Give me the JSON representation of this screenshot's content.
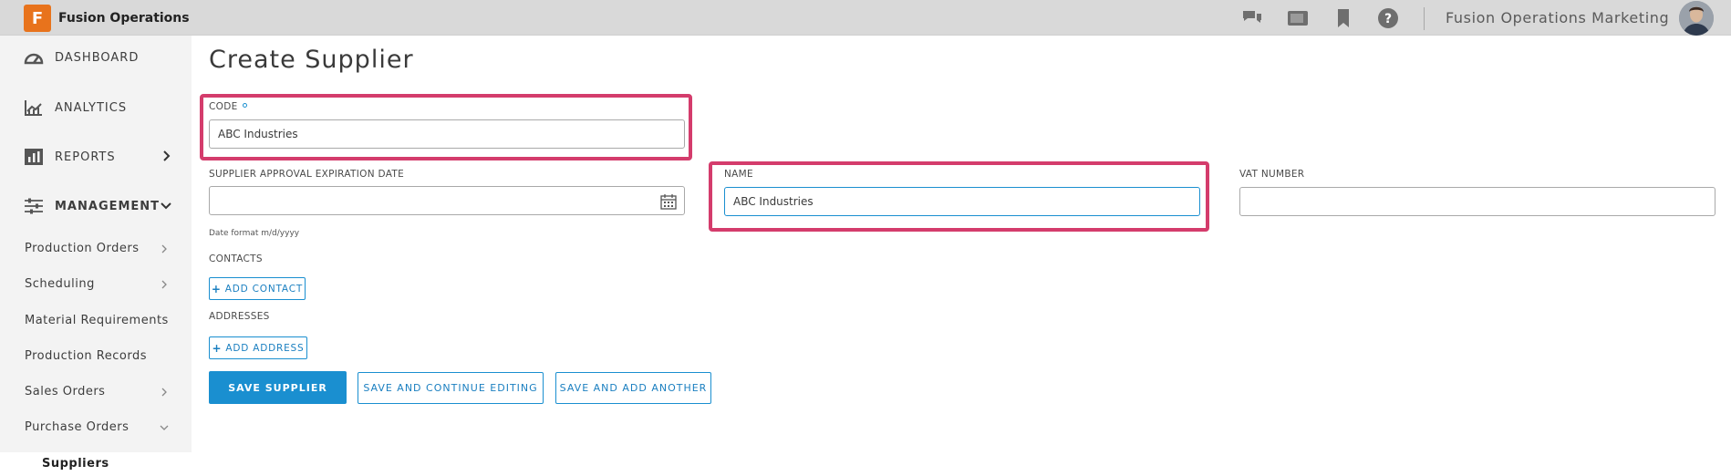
{
  "app": {
    "name": "Fusion Operations",
    "logo_letter": "F"
  },
  "topbar": {
    "user_label": "Fusion Operations Marketing",
    "icons": [
      "chat-icon",
      "tablet-icon",
      "bookmark-icon",
      "help-icon"
    ]
  },
  "sidebar": {
    "main": [
      {
        "label": "DASHBOARD",
        "icon": "gauge-icon"
      },
      {
        "label": "ANALYTICS",
        "icon": "analytics-icon"
      },
      {
        "label": "REPORTS",
        "icon": "reports-icon"
      },
      {
        "label": "MANAGEMENT",
        "icon": "sliders-icon"
      }
    ],
    "sub": [
      {
        "label": "Production Orders"
      },
      {
        "label": "Scheduling"
      },
      {
        "label": "Material Requirements"
      },
      {
        "label": "Production Records"
      },
      {
        "label": "Sales Orders"
      },
      {
        "label": "Purchase Orders"
      },
      {
        "label": "Suppliers"
      }
    ]
  },
  "form": {
    "title": "Create Supplier",
    "code": {
      "label": "CODE",
      "value": "ABC Industries"
    },
    "approval_date": {
      "label": "SUPPLIER APPROVAL EXPIRATION DATE",
      "value": "",
      "hint": "Date format m/d/yyyy"
    },
    "name": {
      "label": "NAME",
      "value": "ABC Industries"
    },
    "vat": {
      "label": "VAT NUMBER",
      "value": ""
    },
    "contacts": {
      "label": "CONTACTS",
      "add_label": "ADD CONTACT"
    },
    "addresses": {
      "label": "ADDRESSES",
      "add_label": "ADD ADDRESS"
    },
    "buttons": {
      "save": "SAVE SUPPLIER",
      "save_continue": "SAVE AND CONTINUE EDITING",
      "save_another": "SAVE AND ADD ANOTHER"
    }
  },
  "colors": {
    "accent": "#1a8fd0",
    "highlight": "#d43c6c",
    "brand": "#e8731c"
  }
}
